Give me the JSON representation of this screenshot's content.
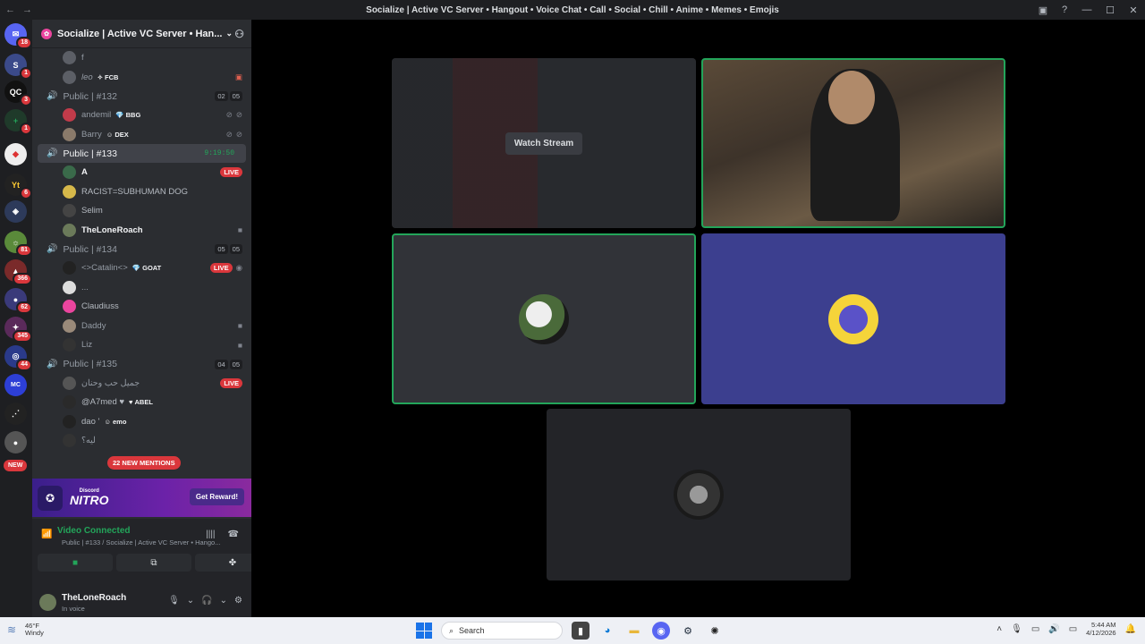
{
  "window": {
    "title": "Socialize | Active VC Server • Hangout • Voice Chat • Call • Social • Chill • Anime • Memes • Emojis"
  },
  "server_rail": {
    "badges": [
      "18",
      "1",
      "3",
      "1",
      "6",
      "81",
      "366",
      "62",
      "345",
      "44"
    ],
    "new_label": "NEW"
  },
  "server": {
    "name": "Socialize | Active VC Server • Han..."
  },
  "top_users": [
    {
      "name": "f"
    },
    {
      "name": "leo",
      "tag": "FCB"
    }
  ],
  "channels": [
    {
      "name": "Public | #132",
      "count_a": "02",
      "count_b": "05",
      "users": [
        {
          "name": "andemil",
          "tag": "BBG"
        },
        {
          "name": "Barry",
          "tag": "DEX"
        }
      ]
    },
    {
      "name": "Public | #133",
      "time": "9:19:50",
      "users": [
        {
          "name": "A",
          "live": "LIVE"
        },
        {
          "name": "RACIST=SUBHUMAN DOG"
        },
        {
          "name": "Selim"
        },
        {
          "name": "TheLoneRoach"
        }
      ]
    },
    {
      "name": "Public | #134",
      "count_a": "05",
      "count_b": "05",
      "users": [
        {
          "name": "<>Catalin<>",
          "tag": "GOAT",
          "live": "LIVE"
        },
        {
          "name": "..."
        },
        {
          "name": "Claudiuss"
        },
        {
          "name": "Daddy"
        },
        {
          "name": "Liz"
        }
      ]
    },
    {
      "name": "Public | #135",
      "count_a": "04",
      "count_b": "05",
      "users": [
        {
          "name": "جميل حب وحنان",
          "live": "LIVE"
        },
        {
          "name": "@A7med ♥",
          "tag": "ABEL"
        },
        {
          "name": "dao '",
          "tag": "emo"
        },
        {
          "name": "ليه؟"
        }
      ]
    }
  ],
  "mentions": "22 NEW MENTIONS",
  "nitro": {
    "small": "Discord",
    "big": "NITRO",
    "button": "Get Reward!"
  },
  "voice": {
    "status": "Video Connected",
    "channel": "Public | #133 / Socialize | Active VC Server • Hango..."
  },
  "user": {
    "name": "TheLoneRoach",
    "status": "In voice"
  },
  "stream": {
    "button": "Watch Stream"
  },
  "taskbar": {
    "temp": "46°F",
    "weather": "Windy",
    "search": "Search",
    "time": "5:44 AM",
    "date": "4/12/2026"
  },
  "colors": {
    "speaking": "#23a55a",
    "live": "#da373c",
    "blurple_tile": "#3c3f8f",
    "nitro": "#6b22a8"
  }
}
